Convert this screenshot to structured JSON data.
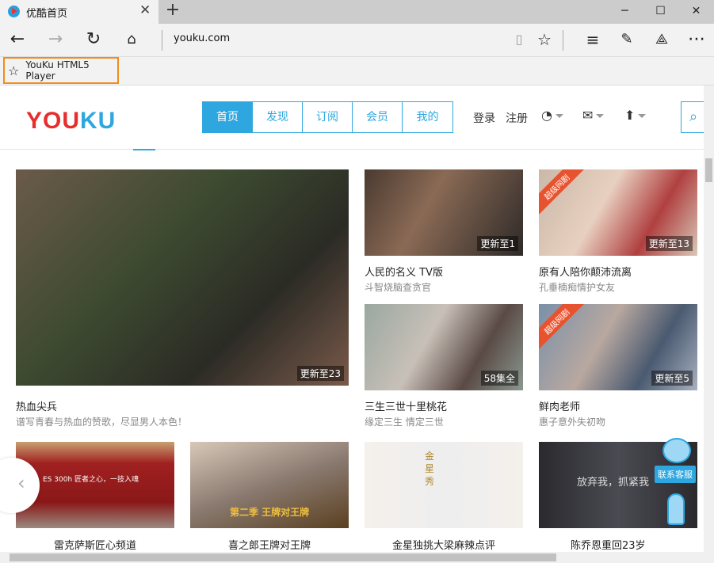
{
  "browser": {
    "tab_title": "优酷首页",
    "address": "youku.com",
    "favorite": "YouKu HTML5 Player",
    "window_controls": [
      "─",
      "☐",
      "✕"
    ],
    "toolbar_icons": [
      "reading-view-icon",
      "favorite-star-icon",
      "hub-icon",
      "web-note-icon",
      "share-icon",
      "more-icon"
    ]
  },
  "header": {
    "logo": "YOUKU",
    "logo_colors": [
      "#e62e2e",
      "#2ea7e0"
    ],
    "accent": "#2ea7e0",
    "nav": [
      "首页",
      "发现",
      "订阅",
      "会员",
      "我的"
    ],
    "login": "登录",
    "register": "注册"
  },
  "featured": {
    "title": "热血尖兵",
    "subtitle": "谱写青春与热血的赞歌，尽显男人本色！",
    "badge": "更新至23"
  },
  "cards": [
    {
      "title": "人民的名义 TV版",
      "subtitle": "斗智烧脑查贪官",
      "badge": "更新至1"
    },
    {
      "title": "原有人陪你颠沛流离",
      "subtitle": "孔垂楠痴情护女友",
      "badge": "更新至13",
      "ribbon": "超级网剧"
    },
    {
      "title": "三生三世十里桃花",
      "subtitle": "缘定三生 情定三世",
      "badge": "58集全"
    },
    {
      "title": "鲜肉老师",
      "subtitle": "惠子意外失初吻",
      "badge": "更新至5",
      "ribbon": "超级网剧"
    }
  ],
  "row3": [
    {
      "title": "雷克萨斯匠心频道",
      "image_text": "ES 300h 匠者之心，一技入魂"
    },
    {
      "title": "喜之郎王牌对王牌",
      "image_text": "第二季 王牌对王牌"
    },
    {
      "title": "金星独挑大梁麻辣点评",
      "image_text": "金星秀"
    },
    {
      "title": "陈乔恩重回23岁",
      "image_text": "放弃我，抓紧我"
    }
  ],
  "service": {
    "label": "联系客服"
  },
  "carousel": {
    "prev": "‹"
  }
}
